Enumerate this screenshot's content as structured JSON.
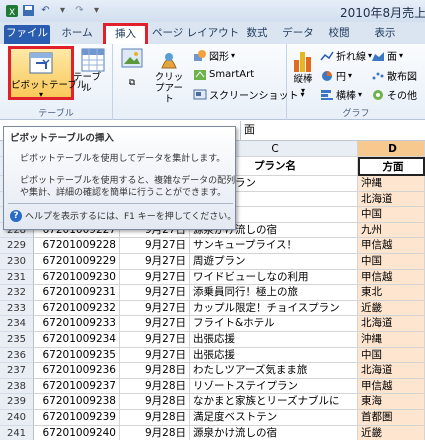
{
  "window": {
    "title": "2010年8月売上"
  },
  "tabs": [
    {
      "label": "ファイル"
    },
    {
      "label": "ホーム"
    },
    {
      "label": "挿入"
    },
    {
      "label": "ページ レイアウト"
    },
    {
      "label": "数式"
    },
    {
      "label": "データ"
    },
    {
      "label": "校閲"
    },
    {
      "label": "表示"
    }
  ],
  "ribbon": {
    "table_group": {
      "label": "テーブル",
      "pivot": "ピボットテーブル",
      "table": "テーブル"
    },
    "illus_group": {
      "clipart": "クリップアート",
      "shapes": "図形",
      "smartart": "SmartArt",
      "screenshot": "スクリーンショット"
    },
    "chart_group": {
      "label": "グラフ",
      "column": "縦棒",
      "line": "折れ線",
      "pie": "円",
      "bar": "横棒",
      "area": "面",
      "scatter": "散布図",
      "other": "その他"
    }
  },
  "formula": {
    "value": "面"
  },
  "columns": {
    "C": "C",
    "D": "D"
  },
  "header": {
    "plan": "プラン名",
    "region": "方面"
  },
  "tooltip": {
    "title": "ピボットテーブルの挿入",
    "line1": "ピボットテーブルを使用してデータを集計します。",
    "line2": "ピボットテーブルを使用すると、複雑なデータの配列",
    "line3": "や集計、詳細の確認を簡単に行うことができます。",
    "help": "ヘルプを表示するには、F1 キーを押してください。"
  },
  "rows": [
    {
      "n": "",
      "code": "",
      "date": "",
      "plan": "ステイブラン",
      "region": "沖縄"
    },
    {
      "n": "",
      "code": "",
      "date": "",
      "plan": "名人",
      "region": "北海道"
    },
    {
      "n": "",
      "code": "",
      "date": "",
      "plan": "イライト",
      "region": "中国"
    },
    {
      "n": "228",
      "code": "67201009227",
      "date": "9月27日",
      "plan": "源泉かけ流しの宿",
      "region": "九州"
    },
    {
      "n": "229",
      "code": "67201009228",
      "date": "9月27日",
      "plan": "サンキュープライス！",
      "region": "甲信越"
    },
    {
      "n": "230",
      "code": "67201009229",
      "date": "9月27日",
      "plan": "周遊プラン",
      "region": "中国"
    },
    {
      "n": "231",
      "code": "67201009230",
      "date": "9月27日",
      "plan": "ワイドビューしなの利用",
      "region": "甲信越"
    },
    {
      "n": "232",
      "code": "67201009231",
      "date": "9月27日",
      "plan": "添乗員同行！極上の旅",
      "region": "東北"
    },
    {
      "n": "233",
      "code": "67201009232",
      "date": "9月27日",
      "plan": "カップル限定！チョイスプラン",
      "region": "近畿"
    },
    {
      "n": "234",
      "code": "67201009233",
      "date": "9月27日",
      "plan": "フライト&ホテル",
      "region": "北海道"
    },
    {
      "n": "235",
      "code": "67201009234",
      "date": "9月27日",
      "plan": "出張応援",
      "region": "沖縄"
    },
    {
      "n": "236",
      "code": "67201009235",
      "date": "9月27日",
      "plan": "出張応援",
      "region": "中国"
    },
    {
      "n": "237",
      "code": "67201009236",
      "date": "9月28日",
      "plan": "わたしツアーズ気まま旅",
      "region": "北海道"
    },
    {
      "n": "238",
      "code": "67201009237",
      "date": "9月28日",
      "plan": "リゾートステイプラン",
      "region": "甲信越"
    },
    {
      "n": "239",
      "code": "67201009238",
      "date": "9月28日",
      "plan": "なかまと家族とリーズナブルに",
      "region": "東海"
    },
    {
      "n": "240",
      "code": "67201009239",
      "date": "9月28日",
      "plan": "満足度ベストテン",
      "region": "首都圏"
    },
    {
      "n": "241",
      "code": "67201009240",
      "date": "9月28日",
      "plan": "源泉かけ流しの宿",
      "region": "近畿"
    }
  ]
}
